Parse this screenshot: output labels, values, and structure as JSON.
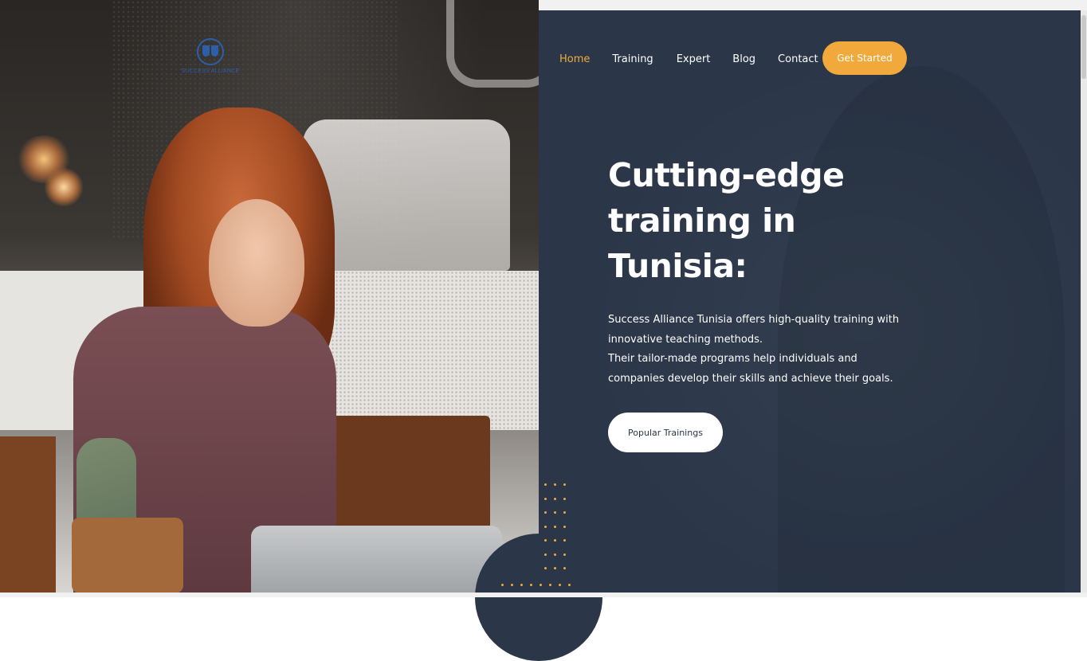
{
  "brand": {
    "name": "SUCCESS ALLIANCE",
    "tagline": "",
    "color": "#2c5fa8"
  },
  "nav": {
    "items": [
      {
        "label": "Home",
        "active": true
      },
      {
        "label": "Training",
        "active": false
      },
      {
        "label": "Expert",
        "active": false
      },
      {
        "label": "Blog",
        "active": false
      },
      {
        "label": "Contact",
        "active": false
      }
    ],
    "cta_label": "Get Started"
  },
  "hero": {
    "title": "Cutting-edge training in Tunisia:",
    "description_1": "Success Alliance Tunisia offers high-quality training with innovative teaching methods.",
    "description_2": "Their tailor-made programs help individuals and companies develop their skills and achieve their goals.",
    "button_label": "Popular Trainings"
  },
  "colors": {
    "panel_bg": "#2b3749",
    "accent": "#f2a93b",
    "text": "#ffffff"
  },
  "icons": [
    "logo-icon",
    "dot-pattern-icon"
  ]
}
